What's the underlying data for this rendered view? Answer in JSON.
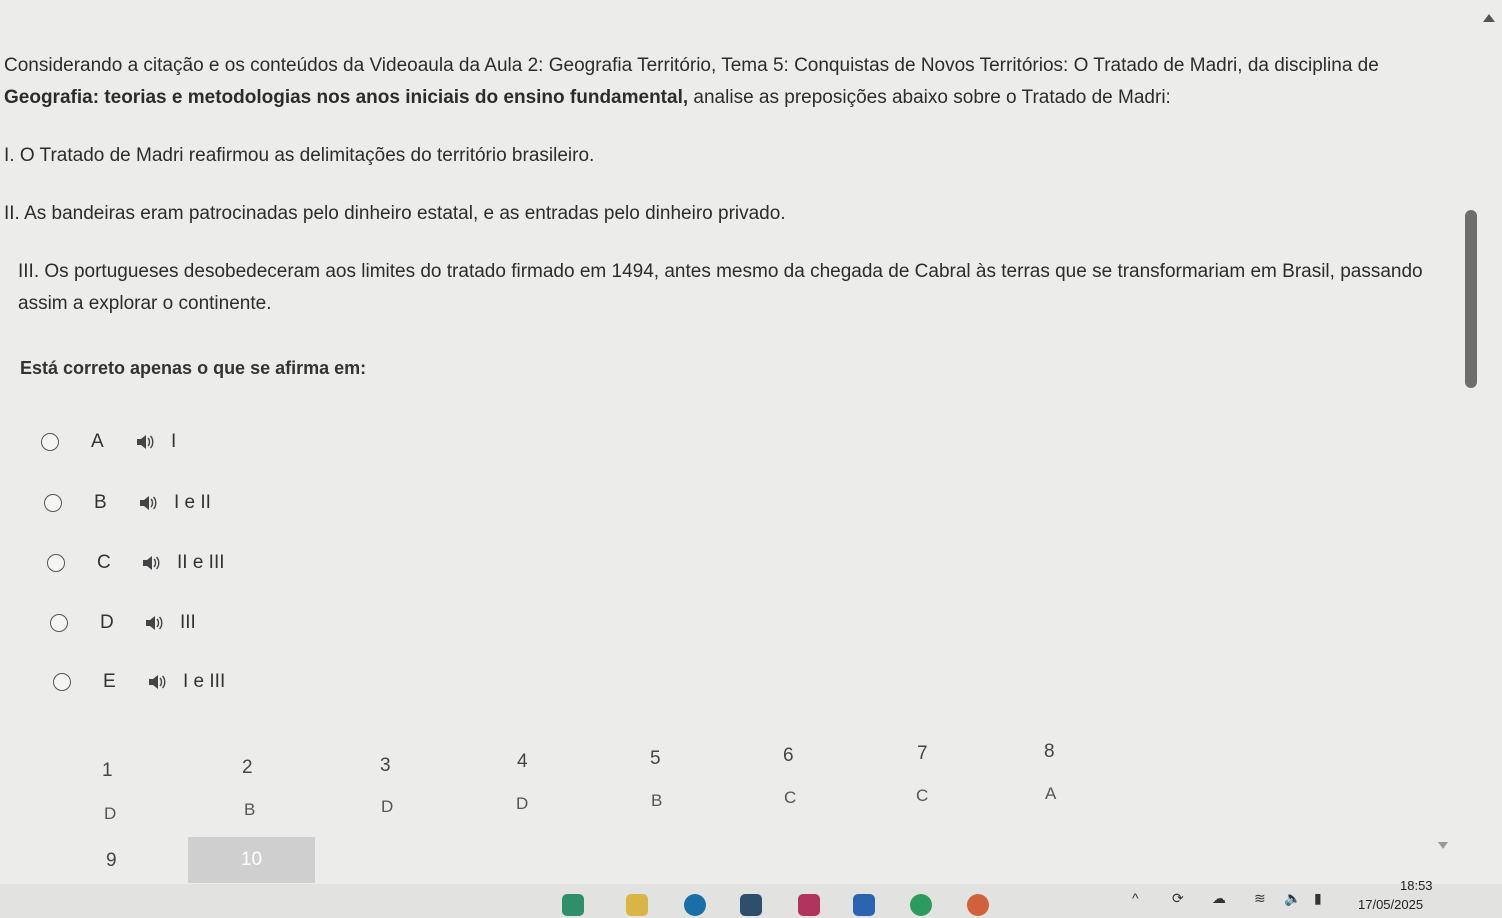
{
  "question": {
    "intro_part1": "Considerando a citação e os conteúdos da Videoaula da Aula 2: Geografia Território, Tema 5: Conquistas de Novos Territórios: O Tratado de Madri, da disciplina de ",
    "intro_bold": "Geografia: teorias e metodologias nos anos iniciais do ensino fundamental,",
    "intro_part2": " analise as preposições abaixo sobre o Tratado de Madri:",
    "statement_1": "I. O Tratado de Madri reafirmou as delimitações do território brasileiro.",
    "statement_2": "II. As bandeiras eram patrocinadas pelo dinheiro estatal, e as entradas pelo dinheiro privado.",
    "statement_3": "III. Os portugueses desobedeceram aos limites do tratado firmado em 1494, antes mesmo da chegada de Cabral às terras que se transformariam em Brasil, passando assim a explorar o continente.",
    "prompt": "Está correto apenas o que se afirma em:"
  },
  "options": [
    {
      "letter": "A",
      "text": "I"
    },
    {
      "letter": "B",
      "text": "I e II"
    },
    {
      "letter": "C",
      "text": "II e III"
    },
    {
      "letter": "D",
      "text": "III"
    },
    {
      "letter": "E",
      "text": "I e III"
    }
  ],
  "navigation": {
    "numbers": [
      "1",
      "2",
      "3",
      "4",
      "5",
      "6",
      "7",
      "8",
      "9",
      "10"
    ],
    "answers": [
      "D",
      "B",
      "D",
      "D",
      "B",
      "C",
      "C",
      "A"
    ],
    "active": "10"
  },
  "taskbar": {
    "time": "18:53",
    "date": "17/05/2025"
  },
  "icons": [
    "speaker-icon",
    "scroll-up-icon",
    "scroll-down-icon",
    "chevron-up-icon",
    "cloud-icon",
    "wifi-icon",
    "volume-icon",
    "battery-icon"
  ]
}
